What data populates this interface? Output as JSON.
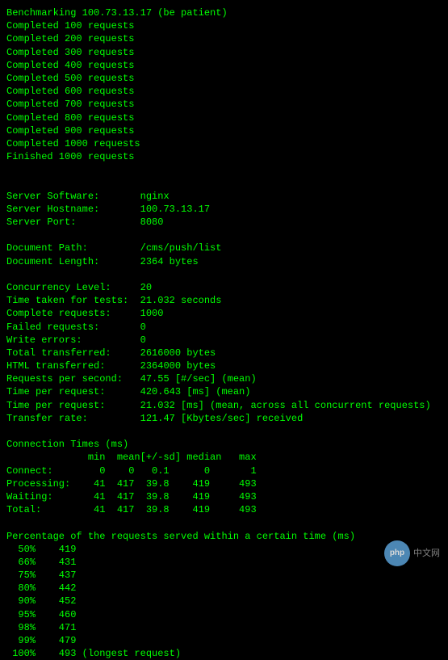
{
  "header": {
    "benchmarking": "Benchmarking 100.73.13.17 (be patient)"
  },
  "progress": [
    "Completed 100 requests",
    "Completed 200 requests",
    "Completed 300 requests",
    "Completed 400 requests",
    "Completed 500 requests",
    "Completed 600 requests",
    "Completed 700 requests",
    "Completed 800 requests",
    "Completed 900 requests",
    "Completed 1000 requests",
    "Finished 1000 requests"
  ],
  "server": {
    "software_label": "Server Software:",
    "software_value": "nginx",
    "hostname_label": "Server Hostname:",
    "hostname_value": "100.73.13.17",
    "port_label": "Server Port:",
    "port_value": "8080"
  },
  "document": {
    "path_label": "Document Path:",
    "path_value": "/cms/push/list",
    "length_label": "Document Length:",
    "length_value": "2364 bytes"
  },
  "stats": {
    "concurrency_label": "Concurrency Level:",
    "concurrency_value": "20",
    "time_taken_label": "Time taken for tests:",
    "time_taken_value": "21.032 seconds",
    "complete_label": "Complete requests:",
    "complete_value": "1000",
    "failed_label": "Failed requests:",
    "failed_value": "0",
    "write_errors_label": "Write errors:",
    "write_errors_value": "0",
    "total_transferred_label": "Total transferred:",
    "total_transferred_value": "2616000 bytes",
    "html_transferred_label": "HTML transferred:",
    "html_transferred_value": "2364000 bytes",
    "rps_label": "Requests per second:",
    "rps_value": "47.55 [#/sec] (mean)",
    "tpr1_label": "Time per request:",
    "tpr1_value": "420.643 [ms] (mean)",
    "tpr2_label": "Time per request:",
    "tpr2_value": "21.032 [ms] (mean, across all concurrent requests)",
    "transfer_label": "Transfer rate:",
    "transfer_value": "121.47 [Kbytes/sec] received"
  },
  "conn_times": {
    "title": "Connection Times (ms)",
    "header": "              min  mean[+/-sd] median   max",
    "connect": "Connect:        0    0   0.1      0       1",
    "processing": "Processing:    41  417  39.8    419     493",
    "waiting": "Waiting:       41  417  39.8    419     493",
    "total": "Total:         41  417  39.8    419     493"
  },
  "percentiles": {
    "title": "Percentage of the requests served within a certain time (ms)",
    "rows": [
      "  50%    419",
      "  66%    431",
      "  75%    437",
      "  80%    442",
      "  90%    452",
      "  95%    460",
      "  98%    471",
      "  99%    479",
      " 100%    493 (longest request)"
    ]
  },
  "watermark": {
    "logo": "php",
    "text": "中文网"
  },
  "chart_data": {
    "type": "table",
    "title": "ApacheBench output",
    "server": {
      "software": "nginx",
      "hostname": "100.73.13.17",
      "port": 8080
    },
    "document": {
      "path": "/cms/push/list",
      "length_bytes": 2364
    },
    "summary": {
      "concurrency_level": 20,
      "time_taken_seconds": 21.032,
      "complete_requests": 1000,
      "failed_requests": 0,
      "write_errors": 0,
      "total_transferred_bytes": 2616000,
      "html_transferred_bytes": 2364000,
      "requests_per_second": 47.55,
      "time_per_request_ms_mean": 420.643,
      "time_per_request_ms_across_all": 21.032,
      "transfer_rate_kbytes_per_sec": 121.47
    },
    "connection_times_ms": {
      "columns": [
        "min",
        "mean",
        "sd",
        "median",
        "max"
      ],
      "connect": [
        0,
        0,
        0.1,
        0,
        1
      ],
      "processing": [
        41,
        417,
        39.8,
        419,
        493
      ],
      "waiting": [
        41,
        417,
        39.8,
        419,
        493
      ],
      "total": [
        41,
        417,
        39.8,
        419,
        493
      ]
    },
    "percentiles_ms": {
      "50": 419,
      "66": 431,
      "75": 437,
      "80": 442,
      "90": 452,
      "95": 460,
      "98": 471,
      "99": 479,
      "100": 493
    }
  }
}
